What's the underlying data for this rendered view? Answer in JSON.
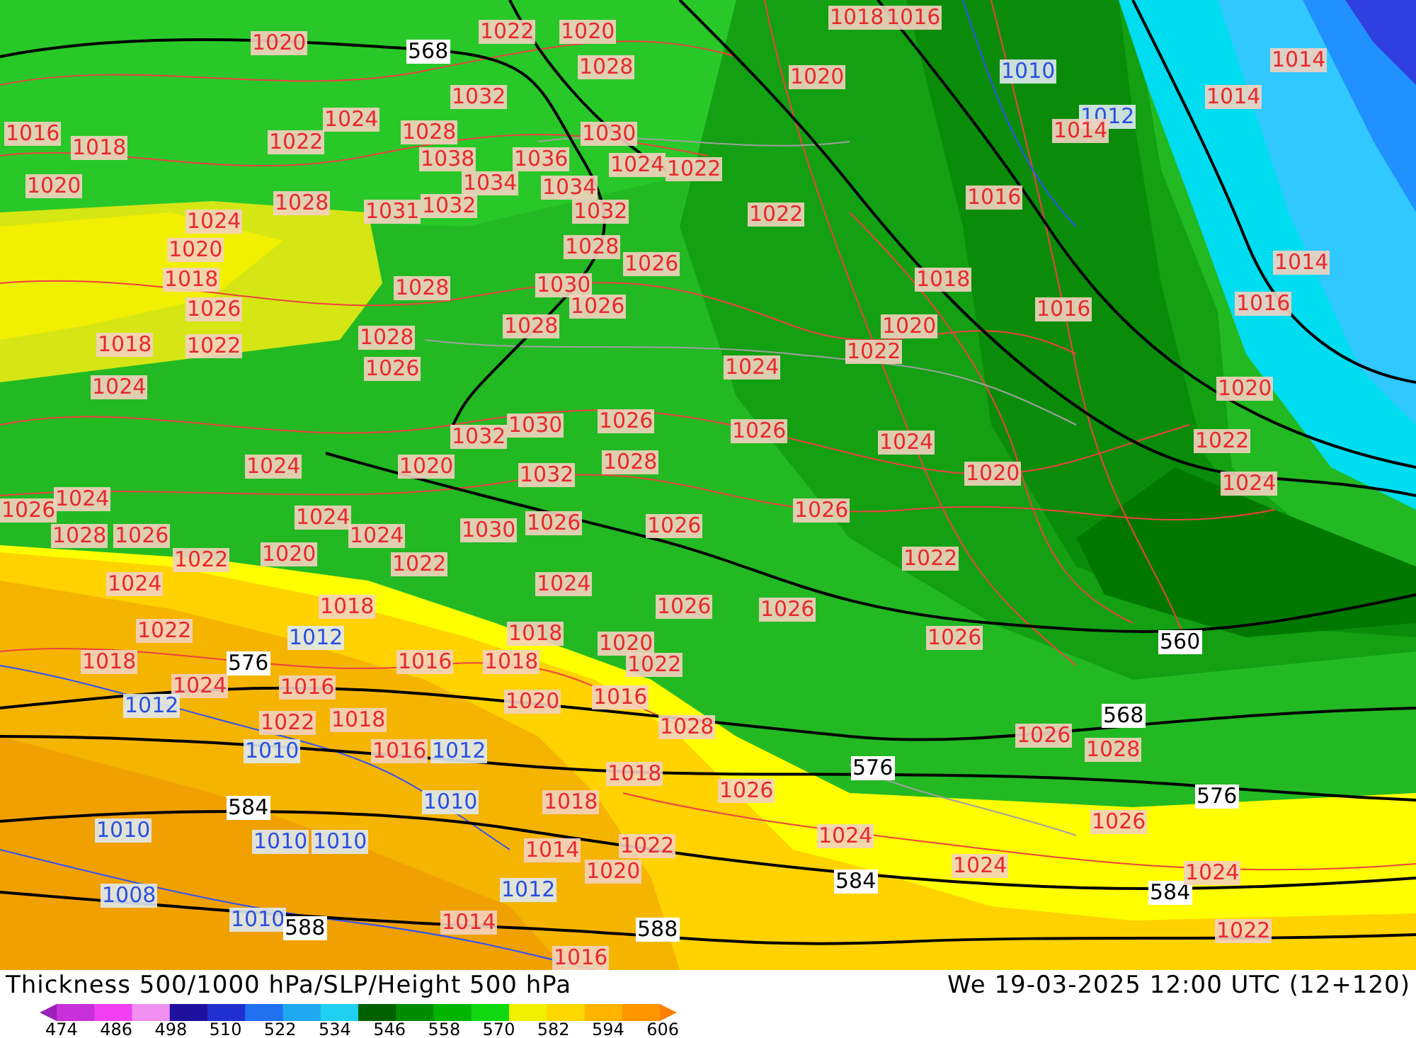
{
  "map": {
    "labels": [
      {
        "text": "1020",
        "kind": "high"
      },
      {
        "text": "568",
        "kind": "height"
      },
      {
        "text": "1022",
        "kind": "high"
      },
      {
        "text": "1020",
        "kind": "high"
      },
      {
        "text": "1018",
        "kind": "high"
      },
      {
        "text": "1016",
        "kind": "high"
      },
      {
        "text": "1028",
        "kind": "high"
      },
      {
        "text": "1020",
        "kind": "high"
      },
      {
        "text": "1010",
        "kind": "low"
      },
      {
        "text": "1014",
        "kind": "high"
      },
      {
        "text": "1032",
        "kind": "high"
      },
      {
        "text": "1024",
        "kind": "high"
      },
      {
        "text": "1014",
        "kind": "high"
      },
      {
        "text": "1012",
        "kind": "low"
      },
      {
        "text": "1016",
        "kind": "high"
      },
      {
        "text": "1018",
        "kind": "high"
      },
      {
        "text": "1022",
        "kind": "high"
      },
      {
        "text": "1028",
        "kind": "high"
      },
      {
        "text": "1030",
        "kind": "high"
      },
      {
        "text": "1014",
        "kind": "high"
      },
      {
        "text": "1038",
        "kind": "high"
      },
      {
        "text": "1036",
        "kind": "high"
      },
      {
        "text": "1024",
        "kind": "high"
      },
      {
        "text": "1022",
        "kind": "high"
      },
      {
        "text": "1020",
        "kind": "high"
      },
      {
        "text": "1034",
        "kind": "high"
      },
      {
        "text": "1028",
        "kind": "high"
      },
      {
        "text": "1034",
        "kind": "high"
      },
      {
        "text": "1031",
        "kind": "high"
      },
      {
        "text": "1032",
        "kind": "high"
      },
      {
        "text": "1032",
        "kind": "high"
      },
      {
        "text": "1022",
        "kind": "high"
      },
      {
        "text": "1016",
        "kind": "high"
      },
      {
        "text": "1024",
        "kind": "high"
      },
      {
        "text": "1020",
        "kind": "high"
      },
      {
        "text": "1028",
        "kind": "high"
      },
      {
        "text": "1026",
        "kind": "high"
      },
      {
        "text": "1014",
        "kind": "high"
      },
      {
        "text": "1018",
        "kind": "high"
      },
      {
        "text": "1028",
        "kind": "high"
      },
      {
        "text": "1030",
        "kind": "high"
      },
      {
        "text": "1018",
        "kind": "high"
      },
      {
        "text": "1026",
        "kind": "high"
      },
      {
        "text": "1026",
        "kind": "high"
      },
      {
        "text": "1016",
        "kind": "high"
      },
      {
        "text": "1016",
        "kind": "high"
      },
      {
        "text": "1018",
        "kind": "high"
      },
      {
        "text": "1022",
        "kind": "high"
      },
      {
        "text": "1028",
        "kind": "high"
      },
      {
        "text": "1028",
        "kind": "high"
      },
      {
        "text": "1020",
        "kind": "high"
      },
      {
        "text": "1022",
        "kind": "high"
      },
      {
        "text": "1024",
        "kind": "high"
      },
      {
        "text": "1026",
        "kind": "high"
      },
      {
        "text": "1024",
        "kind": "high"
      },
      {
        "text": "1020",
        "kind": "high"
      },
      {
        "text": "1032",
        "kind": "high"
      },
      {
        "text": "1030",
        "kind": "high"
      },
      {
        "text": "1026",
        "kind": "high"
      },
      {
        "text": "1026",
        "kind": "high"
      },
      {
        "text": "1024",
        "kind": "high"
      },
      {
        "text": "1022",
        "kind": "high"
      },
      {
        "text": "1024",
        "kind": "high"
      },
      {
        "text": "1020",
        "kind": "high"
      },
      {
        "text": "1032",
        "kind": "high"
      },
      {
        "text": "1028",
        "kind": "high"
      },
      {
        "text": "1020",
        "kind": "high"
      },
      {
        "text": "1024",
        "kind": "high"
      },
      {
        "text": "1026",
        "kind": "high"
      },
      {
        "text": "1024",
        "kind": "high"
      },
      {
        "text": "1024",
        "kind": "high"
      },
      {
        "text": "1026",
        "kind": "high"
      },
      {
        "text": "1028",
        "kind": "high"
      },
      {
        "text": "1026",
        "kind": "high"
      },
      {
        "text": "1024",
        "kind": "high"
      },
      {
        "text": "1030",
        "kind": "high"
      },
      {
        "text": "1026",
        "kind": "high"
      },
      {
        "text": "1026",
        "kind": "high"
      },
      {
        "text": "1022",
        "kind": "high"
      },
      {
        "text": "1020",
        "kind": "high"
      },
      {
        "text": "1022",
        "kind": "high"
      },
      {
        "text": "1022",
        "kind": "high"
      },
      {
        "text": "1024",
        "kind": "high"
      },
      {
        "text": "1024",
        "kind": "high"
      },
      {
        "text": "1018",
        "kind": "high"
      },
      {
        "text": "1026",
        "kind": "high"
      },
      {
        "text": "1026",
        "kind": "high"
      },
      {
        "text": "1022",
        "kind": "high"
      },
      {
        "text": "1012",
        "kind": "low"
      },
      {
        "text": "1018",
        "kind": "high"
      },
      {
        "text": "1020",
        "kind": "high"
      },
      {
        "text": "1026",
        "kind": "high"
      },
      {
        "text": "560",
        "kind": "height"
      },
      {
        "text": "1018",
        "kind": "high"
      },
      {
        "text": "576",
        "kind": "height"
      },
      {
        "text": "1016",
        "kind": "high"
      },
      {
        "text": "1018",
        "kind": "high"
      },
      {
        "text": "1022",
        "kind": "high"
      },
      {
        "text": "1024",
        "kind": "high"
      },
      {
        "text": "1016",
        "kind": "high"
      },
      {
        "text": "1012",
        "kind": "low"
      },
      {
        "text": "1020",
        "kind": "high"
      },
      {
        "text": "1016",
        "kind": "high"
      },
      {
        "text": "1022",
        "kind": "high"
      },
      {
        "text": "1018",
        "kind": "high"
      },
      {
        "text": "1028",
        "kind": "high"
      },
      {
        "text": "568",
        "kind": "height"
      },
      {
        "text": "1010",
        "kind": "low"
      },
      {
        "text": "1016",
        "kind": "high"
      },
      {
        "text": "1012",
        "kind": "low"
      },
      {
        "text": "1026",
        "kind": "high"
      },
      {
        "text": "1028",
        "kind": "high"
      },
      {
        "text": "1018",
        "kind": "high"
      },
      {
        "text": "576",
        "kind": "height"
      },
      {
        "text": "584",
        "kind": "height"
      },
      {
        "text": "1010",
        "kind": "low"
      },
      {
        "text": "1018",
        "kind": "high"
      },
      {
        "text": "1026",
        "kind": "high"
      },
      {
        "text": "576",
        "kind": "height"
      },
      {
        "text": "1010",
        "kind": "low"
      },
      {
        "text": "1010",
        "kind": "low"
      },
      {
        "text": "1010",
        "kind": "low"
      },
      {
        "text": "1014",
        "kind": "high"
      },
      {
        "text": "1022",
        "kind": "high"
      },
      {
        "text": "1024",
        "kind": "high"
      },
      {
        "text": "1026",
        "kind": "high"
      },
      {
        "text": "1008",
        "kind": "low"
      },
      {
        "text": "1012",
        "kind": "low"
      },
      {
        "text": "1020",
        "kind": "high"
      },
      {
        "text": "584",
        "kind": "height"
      },
      {
        "text": "1024",
        "kind": "high"
      },
      {
        "text": "584",
        "kind": "height"
      },
      {
        "text": "1024",
        "kind": "high"
      },
      {
        "text": "1010",
        "kind": "low"
      },
      {
        "text": "588",
        "kind": "height"
      },
      {
        "text": "1014",
        "kind": "high"
      },
      {
        "text": "588",
        "kind": "height"
      },
      {
        "text": "1022",
        "kind": "high"
      },
      {
        "text": "1016",
        "kind": "high"
      }
    ]
  },
  "footer": {
    "title": "Thickness 500/1000 hPa/SLP/Height 500 hPa",
    "datetime": "We 19-03-2025 12:00 UTC (12+120)",
    "colorbar": {
      "ticks": [
        "474",
        "486",
        "498",
        "510",
        "522",
        "534",
        "546",
        "558",
        "570",
        "582",
        "594",
        "606"
      ]
    }
  }
}
